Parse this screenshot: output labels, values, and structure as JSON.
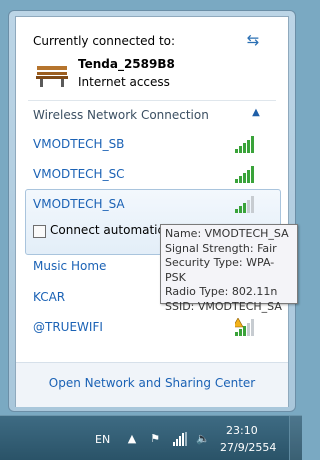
{
  "popup": {
    "current_title": "Currently connected to:",
    "connection": {
      "name": "Tenda_2589B8",
      "status": "Internet access"
    },
    "section_title": "Wireless Network Connection",
    "networks": [
      {
        "name": "VMODTECH_SB",
        "signal_bars": 5
      },
      {
        "name": "VMODTECH_SC",
        "signal_bars": 5
      },
      {
        "name": "VMODTECH_SA",
        "signal_bars": 3,
        "selected": true
      },
      {
        "name": "Music Home",
        "signal_bars": 0
      },
      {
        "name": "KCAR",
        "signal_bars": 0
      },
      {
        "name": "@TRUEWIFI",
        "signal_bars": 3,
        "unsecured_warning": true
      }
    ],
    "connect_auto_label": "Connect automatically",
    "open_center_link": "Open Network and Sharing Center"
  },
  "tooltip": {
    "lines": [
      "Name: VMODTECH_SA",
      "Signal Strength: Fair",
      "Security Type: WPA-PSK",
      "Radio Type: 802.11n",
      "SSID: VMODTECH_SA"
    ]
  },
  "taskbar": {
    "language": "EN",
    "time": "23:10",
    "date": "27/9/2554",
    "icons": [
      "up-arrow-icon",
      "flag-icon",
      "network-icon",
      "volume-icon"
    ]
  },
  "colors": {
    "link": "#1b62b5",
    "signal_on": "#3aa33a",
    "signal_off": "#c7ccd1",
    "taskbar": "#2f5b72"
  }
}
